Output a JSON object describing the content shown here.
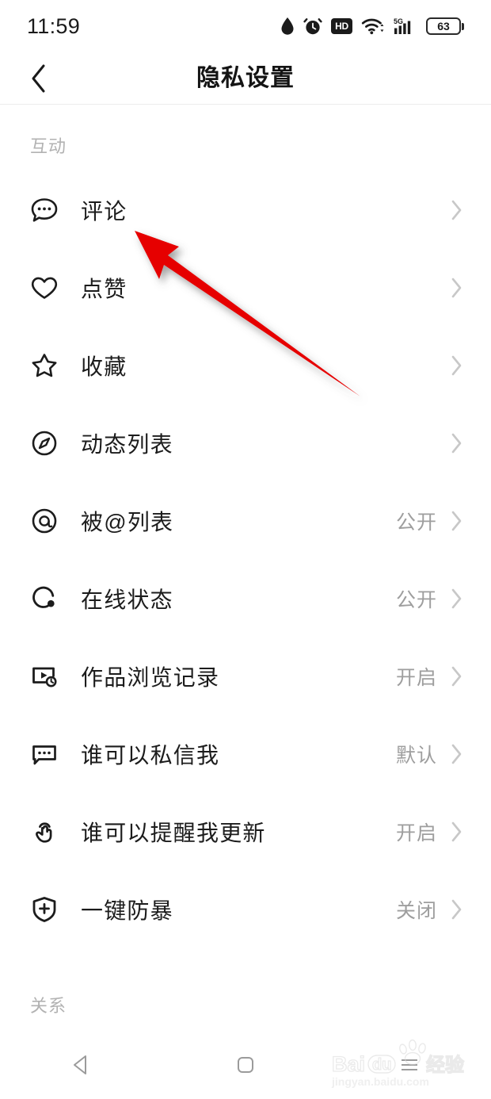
{
  "status_bar": {
    "time": "11:59",
    "icons": [
      "water-drop-icon",
      "alarm-clock-icon",
      "hd-icon",
      "wifi-icon",
      "signal-5g-icon",
      "battery-icon"
    ],
    "hd_label": "HD",
    "network_label": "5G",
    "battery_level": "63"
  },
  "header": {
    "back_icon": "chevron-left-icon",
    "title": "隐私设置"
  },
  "sections": [
    {
      "title": "互动",
      "items": [
        {
          "icon": "comment-bubble-icon",
          "label": "评论",
          "value": ""
        },
        {
          "icon": "heart-icon",
          "label": "点赞",
          "value": ""
        },
        {
          "icon": "star-icon",
          "label": "收藏",
          "value": ""
        },
        {
          "icon": "compass-icon",
          "label": "动态列表",
          "value": ""
        },
        {
          "icon": "at-sign-icon",
          "label": "被@列表",
          "value": "公开"
        },
        {
          "icon": "online-status-icon",
          "label": "在线状态",
          "value": "公开"
        },
        {
          "icon": "video-history-icon",
          "label": "作品浏览记录",
          "value": "开启"
        },
        {
          "icon": "message-icon",
          "label": "谁可以私信我",
          "value": "默认"
        },
        {
          "icon": "tap-hand-icon",
          "label": "谁可以提醒我更新",
          "value": "开启"
        },
        {
          "icon": "shield-plus-icon",
          "label": "一键防暴",
          "value": "关闭"
        }
      ]
    },
    {
      "title": "关系",
      "items": []
    }
  ],
  "annotation": {
    "type": "arrow",
    "color": "#e60000",
    "points_at": "评论"
  },
  "bottom_nav": {
    "buttons": [
      {
        "icon": "back-triangle-icon",
        "name": "nav-back"
      },
      {
        "icon": "home-square-icon",
        "name": "nav-home"
      },
      {
        "icon": "menu-lines-icon",
        "name": "nav-recents"
      }
    ]
  },
  "watermark": {
    "brand": "Bai",
    "brand2": "du",
    "suffix": "经验",
    "url": "jingyan.baidu.com"
  },
  "colors": {
    "label": "#1c1c1c",
    "value": "#9e9e9e",
    "section": "#b2b2b2",
    "chevron": "#c8c8c8",
    "annotation": "#e60000"
  }
}
